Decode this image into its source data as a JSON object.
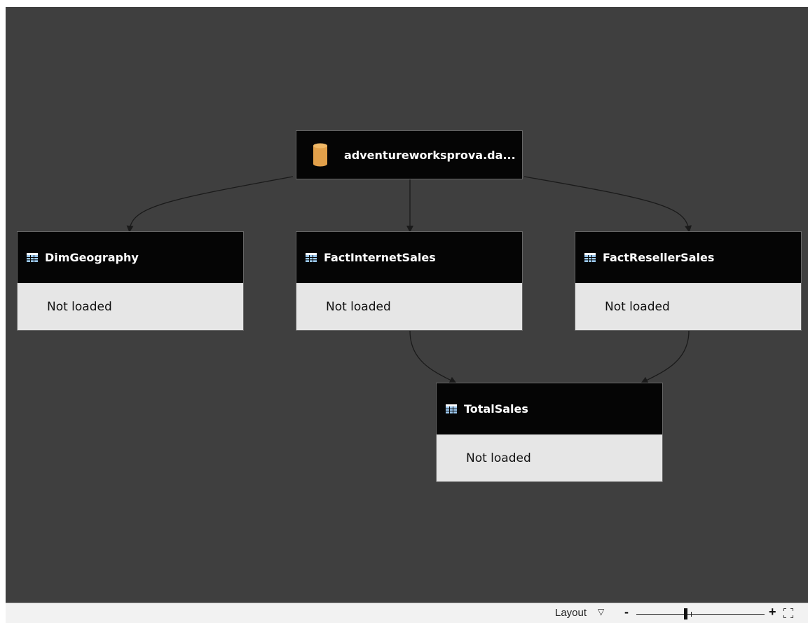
{
  "source": {
    "label": "adventureworksprova.da...",
    "icon": "database-icon",
    "icon_color": "#e2a04a"
  },
  "queries": [
    {
      "name": "DimGeography",
      "status": "Not loaded",
      "icon": "table-icon"
    },
    {
      "name": "FactInternetSales",
      "status": "Not loaded",
      "icon": "table-icon"
    },
    {
      "name": "FactResellerSales",
      "status": "Not loaded",
      "icon": "table-icon"
    },
    {
      "name": "TotalSales",
      "status": "Not loaded",
      "icon": "table-icon"
    }
  ],
  "statusbar": {
    "layout_label": "Layout",
    "layout_dropdown_icon": "triangle-down-icon",
    "zoom_out_label": "-",
    "zoom_in_label": "+",
    "fit_icon": "fit-to-screen-icon"
  },
  "colors": {
    "canvas": "#3f3f3f",
    "header": "#050505",
    "body": "#e6e6e6",
    "table_icon": "#9cc8ef"
  }
}
